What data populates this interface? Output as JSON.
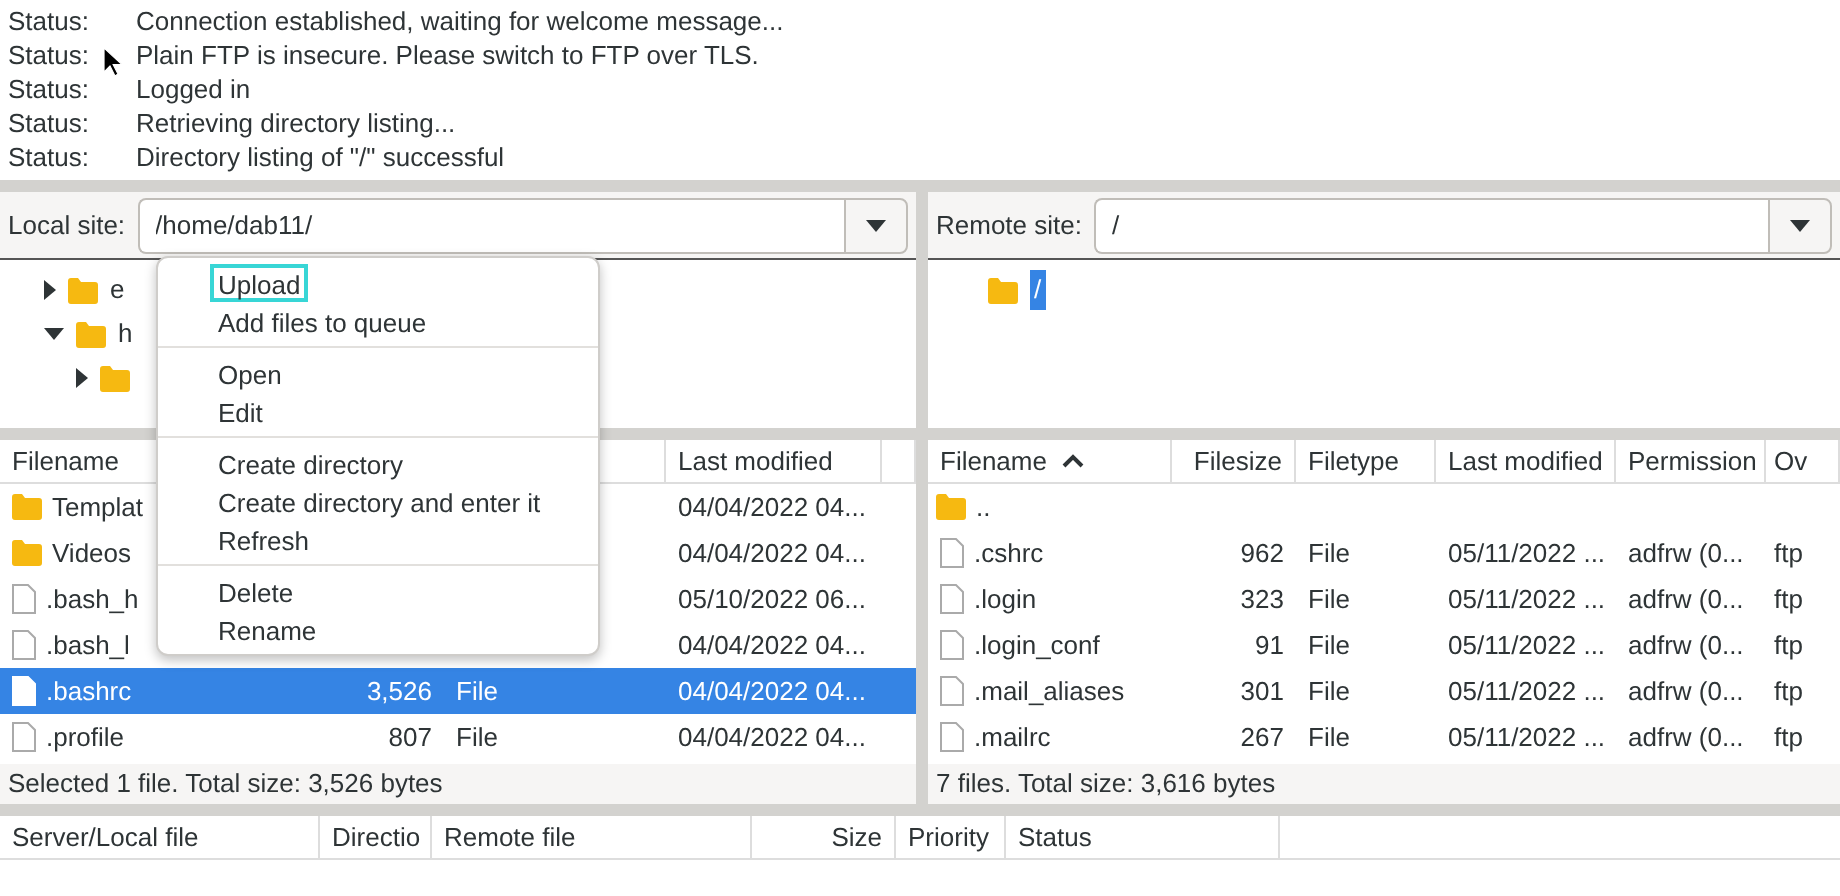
{
  "message_log": [
    {
      "label": "Status:",
      "message": "Connection established, waiting for welcome message..."
    },
    {
      "label": "Status:",
      "message": "Plain FTP is insecure. Please switch to FTP over TLS."
    },
    {
      "label": "Status:",
      "message": "Logged in"
    },
    {
      "label": "Status:",
      "message": "Retrieving directory listing..."
    },
    {
      "label": "Status:",
      "message": "Directory listing of \"/\" successful"
    }
  ],
  "local": {
    "site_label": "Local site:",
    "path": "/home/dab11/",
    "tree": [
      {
        "label": "e",
        "expanded": false
      },
      {
        "label": "h",
        "expanded": true,
        "children": [
          {
            "expanded": false
          }
        ]
      }
    ],
    "columns": [
      {
        "label": "Filename"
      },
      {
        "label": "Last modified"
      }
    ],
    "rows": [
      {
        "kind": "folder",
        "name": "Templat",
        "modified": "04/04/2022 04...",
        "selected": false
      },
      {
        "kind": "folder",
        "name": "Videos",
        "modified": "04/04/2022 04...",
        "selected": false
      },
      {
        "kind": "file",
        "name": ".bash_h",
        "modified": "05/10/2022 06...",
        "selected": false
      },
      {
        "kind": "file",
        "name": ".bash_l",
        "modified": "04/04/2022 04...",
        "selected": false
      },
      {
        "kind": "file",
        "name": ".bashrc",
        "size": "3,526",
        "type": "File",
        "modified": "04/04/2022 04...",
        "selected": true
      },
      {
        "kind": "file",
        "name": ".profile",
        "size": "807",
        "type": "File",
        "modified": "04/04/2022 04...",
        "selected": false
      }
    ],
    "status": "Selected 1 file. Total size: 3,526 bytes"
  },
  "remote": {
    "site_label": "Remote site:",
    "path": "/",
    "tree": [
      {
        "label": "/",
        "selected": true
      }
    ],
    "columns": [
      {
        "label": "Filename",
        "sorted": true
      },
      {
        "label": "Filesize"
      },
      {
        "label": "Filetype"
      },
      {
        "label": "Last modified"
      },
      {
        "label": "Permission"
      },
      {
        "label": "Ov"
      }
    ],
    "rows": [
      {
        "kind": "folder",
        "cells": [
          ".."
        ],
        "selected": false
      },
      {
        "kind": "file",
        "cells": [
          ".cshrc",
          "962",
          "File",
          "05/11/2022 ...",
          "adfrw (0...",
          "ftp"
        ],
        "selected": false
      },
      {
        "kind": "file",
        "cells": [
          ".login",
          "323",
          "File",
          "05/11/2022 ...",
          "adfrw (0...",
          "ftp"
        ],
        "selected": false
      },
      {
        "kind": "file",
        "cells": [
          ".login_conf",
          "91",
          "File",
          "05/11/2022 ...",
          "adfrw (0...",
          "ftp"
        ],
        "selected": false
      },
      {
        "kind": "file",
        "cells": [
          ".mail_aliases",
          "301",
          "File",
          "05/11/2022 ...",
          "adfrw (0...",
          "ftp"
        ],
        "selected": false
      },
      {
        "kind": "file",
        "cells": [
          ".mailrc",
          "267",
          "File",
          "05/11/2022 ...",
          "adfrw (0...",
          "ftp"
        ],
        "selected": false
      }
    ],
    "status": "7 files. Total size: 3,616 bytes"
  },
  "context_menu": [
    [
      {
        "label": "Upload",
        "selected": true
      },
      {
        "label": "Add files to queue",
        "selected": false
      }
    ],
    [
      {
        "label": "Open",
        "selected": false
      },
      {
        "label": "Edit",
        "selected": false
      }
    ],
    [
      {
        "label": "Create directory",
        "selected": false
      },
      {
        "label": "Create directory and enter it",
        "selected": false
      },
      {
        "label": "Refresh",
        "selected": false
      }
    ],
    [
      {
        "label": "Delete",
        "selected": false
      },
      {
        "label": "Rename",
        "selected": false
      }
    ]
  ],
  "queue": {
    "columns": [
      "Server/Local file",
      "Directio",
      "Remote file",
      "Size",
      "Priority",
      "Status"
    ]
  }
}
